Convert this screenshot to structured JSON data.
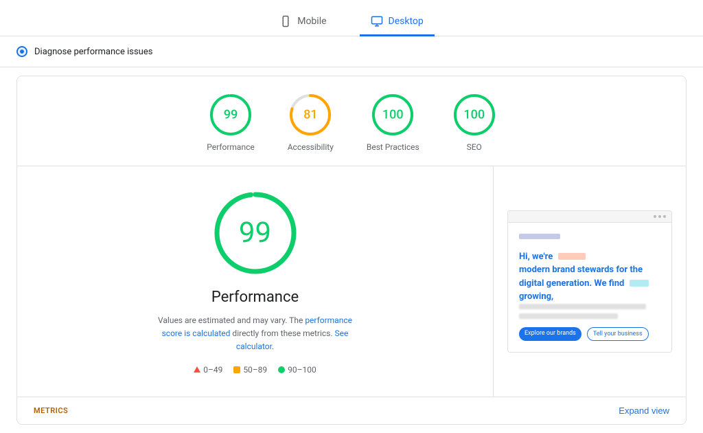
{
  "tabs": [
    {
      "id": "mobile",
      "label": "Mobile",
      "active": false
    },
    {
      "id": "desktop",
      "label": "Desktop",
      "active": true
    }
  ],
  "diagnose": {
    "text": "Diagnose performance issues"
  },
  "scores": [
    {
      "id": "performance",
      "value": 99,
      "label": "Performance",
      "color": "#0cce6b",
      "pct": 98
    },
    {
      "id": "accessibility",
      "value": 81,
      "label": "Accessibility",
      "color": "#ffa400",
      "pct": 80
    },
    {
      "id": "best-practices",
      "value": 100,
      "label": "Best Practices",
      "color": "#0cce6b",
      "pct": 100
    },
    {
      "id": "seo",
      "value": 100,
      "label": "SEO",
      "color": "#0cce6b",
      "pct": 100
    }
  ],
  "main": {
    "big_score": 99,
    "label": "Performance",
    "description_text": "Values are estimated and may vary. The",
    "link1": "performance score is calculated",
    "description_mid": "directly from these metrics.",
    "link2": "See calculator.",
    "legend": [
      {
        "type": "triangle",
        "color": "#ff4e42",
        "range": "0–49"
      },
      {
        "type": "square",
        "color": "#ffa400",
        "range": "50–89"
      },
      {
        "type": "circle",
        "color": "#0cce6b",
        "range": "90–100"
      }
    ]
  },
  "metrics": {
    "label": "METRICS",
    "expand": "Expand view"
  },
  "preview": {
    "heading": "Hi, we're",
    "subheading": "modern brand stewards for the",
    "subheading2": "digital generation. We find",
    "subheading3": "growing,",
    "btn1": "Explore our brands",
    "btn2": "Tell your business"
  }
}
